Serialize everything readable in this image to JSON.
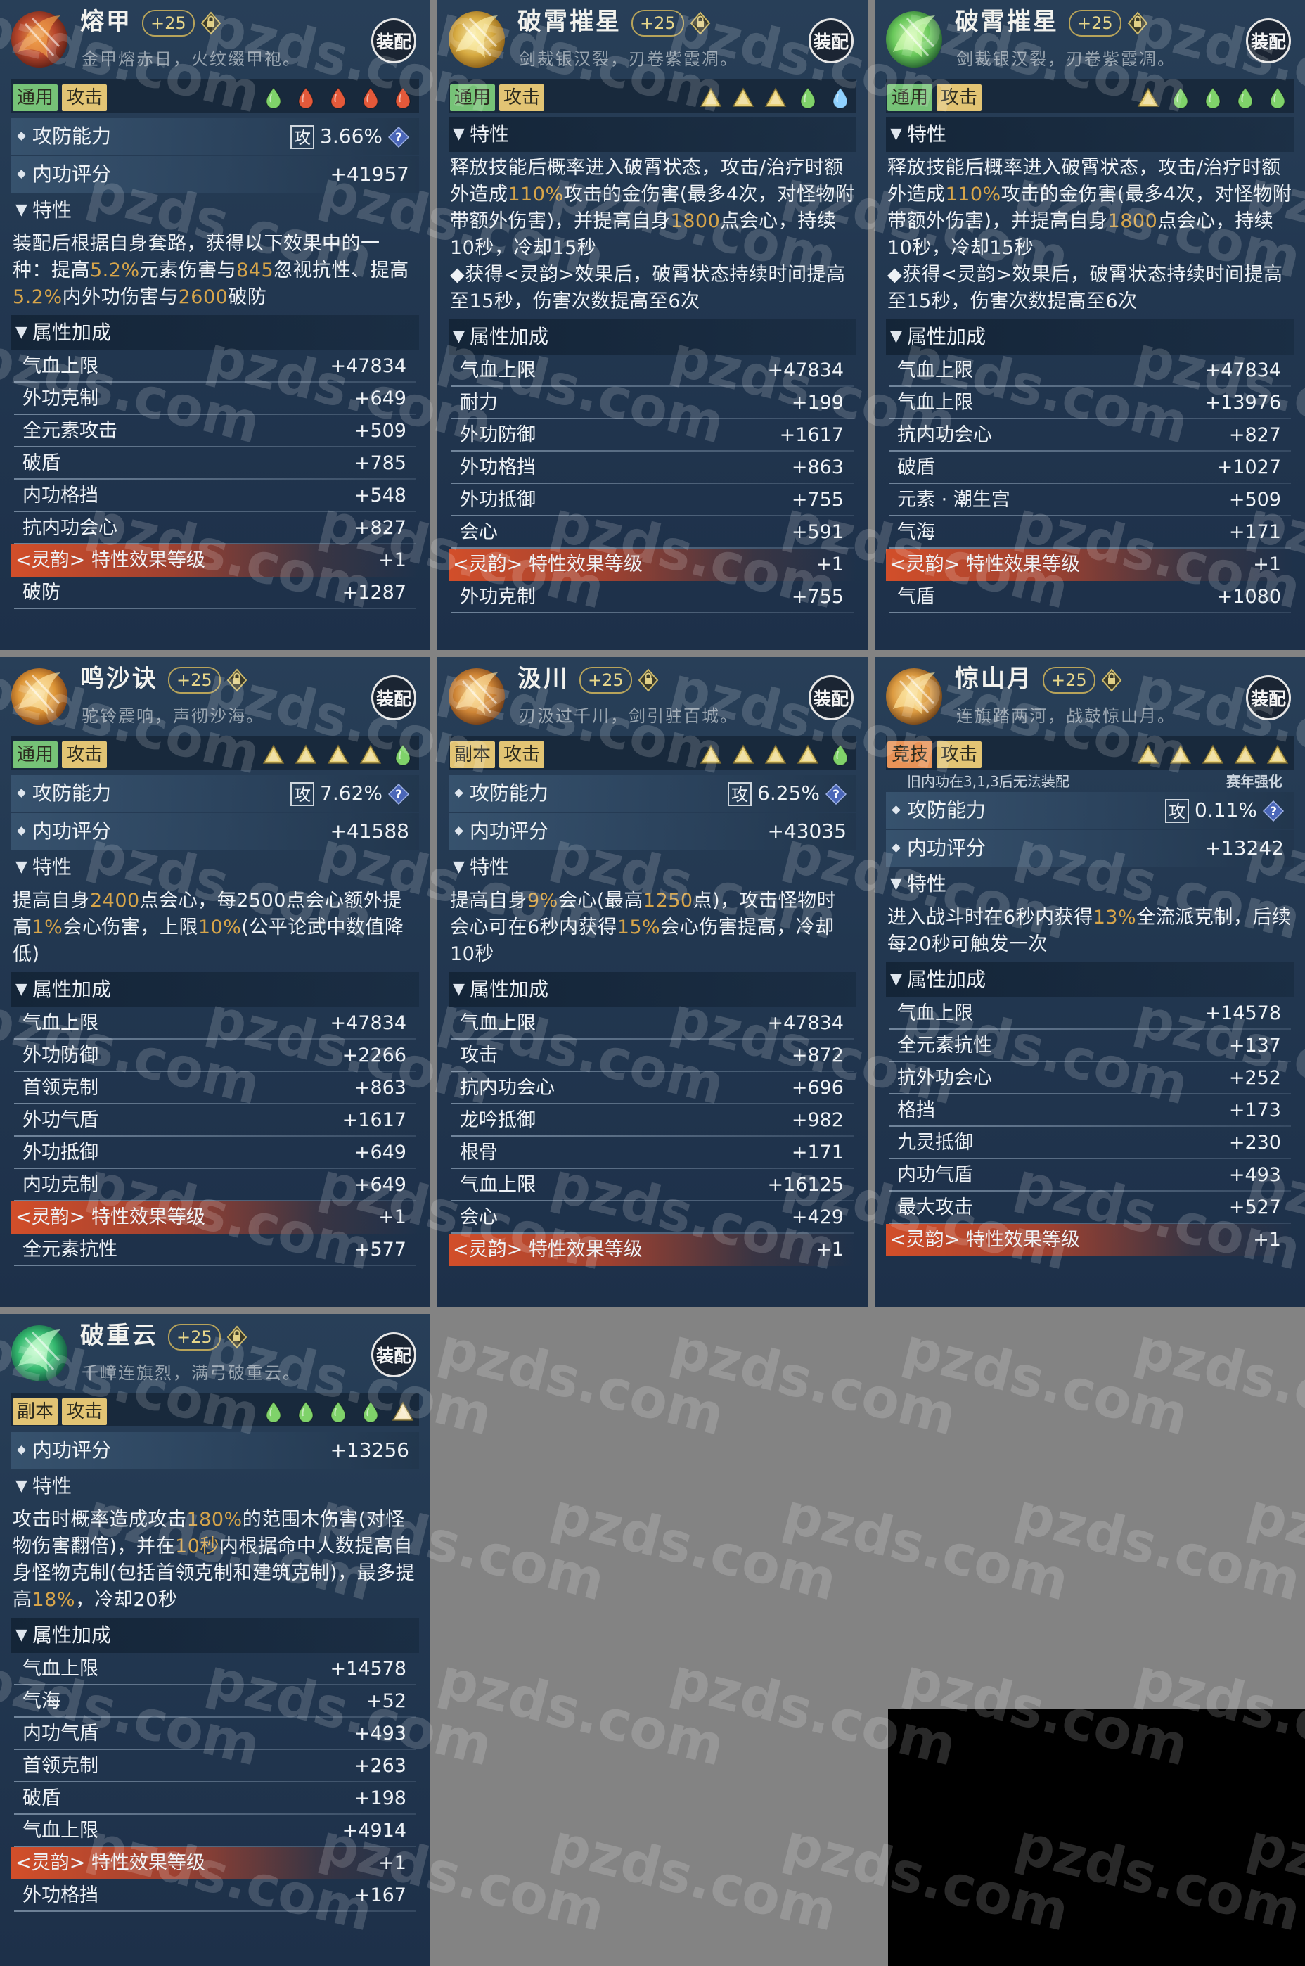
{
  "equip_label": "装配",
  "sections": {
    "attack_defense": "攻防能力",
    "inner_score": "内功评分",
    "trait": "特性",
    "attr_bonus": "属性加成"
  },
  "atk_badge": "攻",
  "cards": [
    {
      "name": "熔甲",
      "level": "+25",
      "motto": "金甲熔赤日，火纹缀甲袍。",
      "tags": [
        "通用",
        "攻击"
      ],
      "gems": [
        "green",
        "red",
        "red",
        "red",
        "red"
      ],
      "ability_pct": "3.66%",
      "inner_score": "+41957",
      "trait_html": "装配后根据自身套路，获得以下效果中的一种：提高<span class=\"hl\">5.2%</span>元素伤害与<span class=\"hl\">845</span>忽视抗性、提高<span class=\"hl\">5.2%</span>内外功伤害与<span class=\"hl\">2600</span>破防",
      "attrs": [
        {
          "label": "气血上限",
          "value": "+47834"
        },
        {
          "label": "外功克制",
          "value": "+649"
        },
        {
          "label": "全元素攻击",
          "value": "+509"
        },
        {
          "label": "破盾",
          "value": "+785"
        },
        {
          "label": "内功格挡",
          "value": "+548"
        },
        {
          "label": "抗内功会心",
          "value": "+827"
        },
        {
          "label": "<灵韵> 特性效果等级",
          "value": "+1",
          "spirit": true
        },
        {
          "label": "破防",
          "value": "+1287"
        }
      ]
    },
    {
      "name": "破霄摧星",
      "level": "+25",
      "motto": "剑裁银汉裂，刃卷紫霞凋。",
      "tags": [
        "通用",
        "攻击"
      ],
      "gems": [
        "gold",
        "gold",
        "gold",
        "green",
        "blue"
      ],
      "trait_html": "释放技能后概率进入破霄状态，攻击/治疗时额外造成<span class=\"hl\">110%</span>攻击的金伤害(最多4次，对怪物附带额外伤害)，并提高自身<span class=\"hl\">1800</span>点会心，持续10秒，冷却15秒<br>◆获得<灵韵>效果后，破霄状态持续时间提高至15秒，伤害次数提高至6次",
      "attrs": [
        {
          "label": "气血上限",
          "value": "+47834"
        },
        {
          "label": "耐力",
          "value": "+199"
        },
        {
          "label": "外功防御",
          "value": "+1617"
        },
        {
          "label": "外功格挡",
          "value": "+863"
        },
        {
          "label": "外功抵御",
          "value": "+755"
        },
        {
          "label": "会心",
          "value": "+591"
        },
        {
          "label": "<灵韵> 特性效果等级",
          "value": "+1",
          "spirit": true
        },
        {
          "label": "外功克制",
          "value": "+755"
        }
      ]
    },
    {
      "name": "破霄摧星",
      "level": "+25",
      "motto": "剑裁银汉裂，刃卷紫霞凋。",
      "tags": [
        "通用",
        "攻击"
      ],
      "gems": [
        "gold",
        "green",
        "green",
        "green",
        "green"
      ],
      "trait_html": "释放技能后概率进入破霄状态，攻击/治疗时额外造成<span class=\"hl\">110%</span>攻击的金伤害(最多4次，对怪物附带额外伤害)，并提高自身<span class=\"hl\">1800</span>点会心，持续10秒，冷却15秒<br>◆获得<灵韵>效果后，破霄状态持续时间提高至15秒，伤害次数提高至6次",
      "attrs": [
        {
          "label": "气血上限",
          "value": "+47834"
        },
        {
          "label": "气血上限",
          "value": "+13976"
        },
        {
          "label": "抗内功会心",
          "value": "+827"
        },
        {
          "label": "破盾",
          "value": "+1027"
        },
        {
          "label": "元素 · 潮生宫",
          "value": "+509"
        },
        {
          "label": "气海",
          "value": "+171"
        },
        {
          "label": "<灵韵> 特性效果等级",
          "value": "+1",
          "spirit": true
        },
        {
          "label": "气盾",
          "value": "+1080"
        }
      ]
    },
    {
      "name": "鸣沙诀",
      "level": "+25",
      "motto": "驼铃震响，声彻沙海。",
      "tags": [
        "通用",
        "攻击"
      ],
      "gems": [
        "gold",
        "gold",
        "gold",
        "gold",
        "green"
      ],
      "ability_pct": "7.62%",
      "inner_score": "+41588",
      "trait_html": "提高自身<span class=\"hl\">2400</span>点会心，每2500点会心额外提高<span class=\"hl\">1%</span>会心伤害，上限<span class=\"hl\">10%</span>(公平论武中数值降低)",
      "attrs": [
        {
          "label": "气血上限",
          "value": "+47834"
        },
        {
          "label": "外功防御",
          "value": "+2266"
        },
        {
          "label": "首领克制",
          "value": "+863"
        },
        {
          "label": "外功气盾",
          "value": "+1617"
        },
        {
          "label": "外功抵御",
          "value": "+649"
        },
        {
          "label": "内功克制",
          "value": "+649"
        },
        {
          "label": "<灵韵> 特性效果等级",
          "value": "+1",
          "spirit": true
        },
        {
          "label": "全元素抗性",
          "value": "+577"
        }
      ]
    },
    {
      "name": "汲川",
      "level": "+25",
      "motto": "刃汲过千川，剑引驻百城。",
      "tags": [
        "副本",
        "攻击"
      ],
      "gems": [
        "gold",
        "gold",
        "gold",
        "gold",
        "green"
      ],
      "ability_pct": "6.25%",
      "inner_score": "+43035",
      "trait_html": "提高自身<span class=\"hl\">9%</span>会心(最高<span class=\"hl\">1250</span>点)，攻击怪物时会心可在6秒内获得<span class=\"hl\">15%</span>会心伤害提高，冷却10秒",
      "attrs": [
        {
          "label": "气血上限",
          "value": "+47834"
        },
        {
          "label": "攻击",
          "value": "+872"
        },
        {
          "label": "抗内功会心",
          "value": "+696"
        },
        {
          "label": "龙吟抵御",
          "value": "+982"
        },
        {
          "label": "根骨",
          "value": "+171"
        },
        {
          "label": "气血上限",
          "value": "+16125"
        },
        {
          "label": "会心",
          "value": "+429"
        },
        {
          "label": "<灵韵> 特性效果等级",
          "value": "+1",
          "spirit": true
        }
      ]
    },
    {
      "name": "惊山月",
      "level": "+25",
      "motto": "连旗踏两河，战鼓惊山月。",
      "tags": [
        "竞技",
        "攻击"
      ],
      "gems": [
        "gold",
        "gold",
        "gold",
        "gold",
        "gold"
      ],
      "clip_text": "旧内功在3,1,3后无法装配",
      "clip_right": "赛年强化",
      "ability_pct": "0.11%",
      "inner_score": "+13242",
      "trait_html": "进入战斗时在6秒内获得<span class=\"hl\">13%</span>全流派克制，后续每20秒可触发一次",
      "attrs": [
        {
          "label": "气血上限",
          "value": "+14578"
        },
        {
          "label": "全元素抗性",
          "value": "+137"
        },
        {
          "label": "抗外功会心",
          "value": "+252"
        },
        {
          "label": "格挡",
          "value": "+173"
        },
        {
          "label": "九灵抵御",
          "value": "+230"
        },
        {
          "label": "内功气盾",
          "value": "+493"
        },
        {
          "label": "最大攻击",
          "value": "+527"
        },
        {
          "label": "<灵韵> 特性效果等级",
          "value": "+1",
          "spirit": true
        }
      ]
    },
    {
      "name": "破重云",
      "level": "+25",
      "motto": "千嶂连旗烈，满弓破重云。",
      "tags": [
        "副本",
        "攻击"
      ],
      "gems": [
        "green",
        "green",
        "green",
        "green",
        "cream"
      ],
      "inner_score": "+13256",
      "trait_html": "攻击时概率造成攻击<span class=\"hl\">180%</span>的范围木伤害(对怪物伤害翻倍)，并在<span class=\"hl\">10秒</span>内根据命中人数提高自身怪物克制(包括首领克制和建筑克制)，最多提高<span class=\"hl\">18%</span>，冷却20秒",
      "attrs": [
        {
          "label": "气血上限",
          "value": "+14578"
        },
        {
          "label": "气海",
          "value": "+52"
        },
        {
          "label": "内功气盾",
          "value": "+493"
        },
        {
          "label": "首领克制",
          "value": "+263"
        },
        {
          "label": "破盾",
          "value": "+198"
        },
        {
          "label": "气血上限",
          "value": "+4914"
        },
        {
          "label": "<灵韵> 特性效果等级",
          "value": "+1",
          "spirit": true
        },
        {
          "label": "外功格挡",
          "value": "+167"
        }
      ]
    }
  ],
  "watermark": "pzds.com",
  "colors": {
    "page_bg": "#838383",
    "card_bg": "#223750",
    "highlight": "#d7a54a",
    "spirit_bar": "#dc5028",
    "tag_green": "#76c277",
    "tag_gold": "#e2c474",
    "tag_orange": "#e89358"
  }
}
